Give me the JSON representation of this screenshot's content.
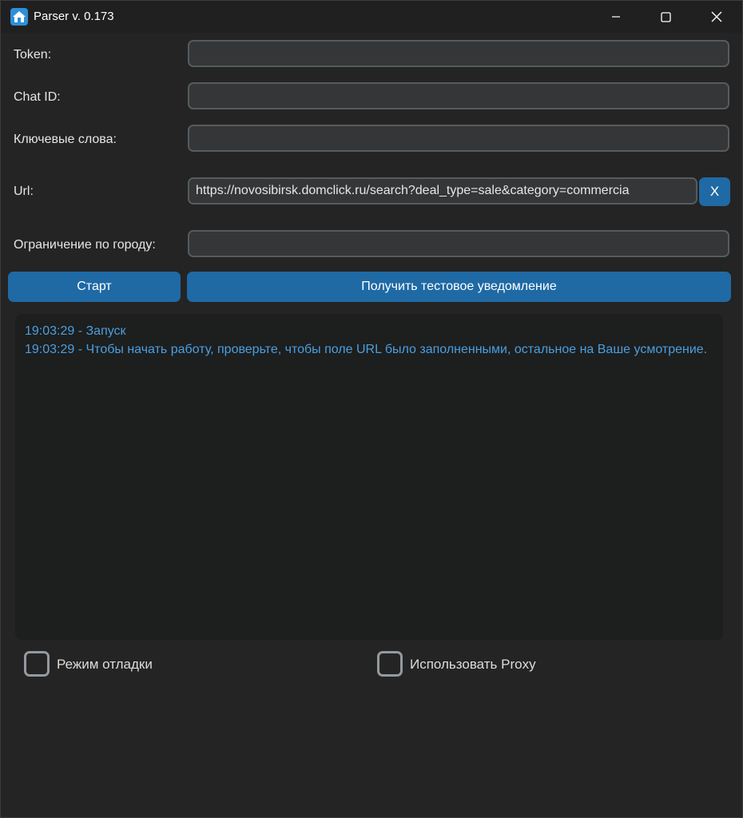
{
  "window": {
    "title": "Parser v. 0.173",
    "icon": "house-app-icon",
    "controls": [
      "minimize-icon",
      "maximize-icon",
      "close-icon"
    ]
  },
  "form": {
    "token_label": "Token:",
    "token_value": "",
    "chat_id_label": "Chat ID:",
    "chat_id_value": "",
    "keywords_label": "Ключевые слова:",
    "keywords_value": "",
    "url_label": "Url:",
    "url_value": "https://novosibirsk.domclick.ru/search?deal_type=sale&category=commercia",
    "url_clear_label": "X",
    "city_label": "Ограничение по городу:",
    "city_value": ""
  },
  "actions": {
    "start_label": "Старт",
    "test_notification_label": "Получить тестовое уведомление"
  },
  "log": {
    "lines": [
      "19:03:29 - Запуск",
      "19:03:29 - Чтобы начать работу, проверьте, чтобы поле URL было заполненными, остальное на Ваше усмотрение."
    ]
  },
  "options": {
    "debug_label": "Режим отладки",
    "debug_checked": false,
    "proxy_label": "Использовать Proxy",
    "proxy_checked": false
  },
  "colors": {
    "accent": "#1f6aa5",
    "log_text": "#4a9fe0",
    "background": "#242424",
    "field_bg": "#343638"
  }
}
